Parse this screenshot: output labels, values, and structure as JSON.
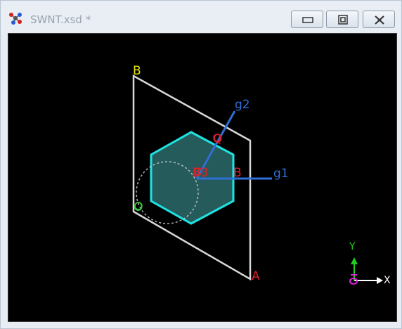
{
  "window": {
    "title": "SWNT.xsd *"
  },
  "colors": {
    "lattice_vector": "#2f6fd6",
    "hexagon_edge": "#1fe3e3",
    "hexagon_fill": "#2b6b6b",
    "cell_edge": "#d8d8d8",
    "label_red": "#e0202a",
    "label_yellow": "#e6e600",
    "label_green": "#33cc33",
    "axis_y": "#22cc22",
    "axis_z": "#e020e0"
  },
  "scene": {
    "labels": {
      "corner_b": "B",
      "corner_a": "A",
      "origin": "O",
      "vector_g1": "g1",
      "vector_g2": "g2",
      "point_q": "Q",
      "point_b_right": "B",
      "point_center": "B3"
    },
    "axes": {
      "y": "Y",
      "x": "X"
    }
  },
  "icons": {
    "app": "molecule-icon",
    "minimize": "minimize-icon",
    "maximize": "maximize-icon",
    "close": "close-icon"
  }
}
